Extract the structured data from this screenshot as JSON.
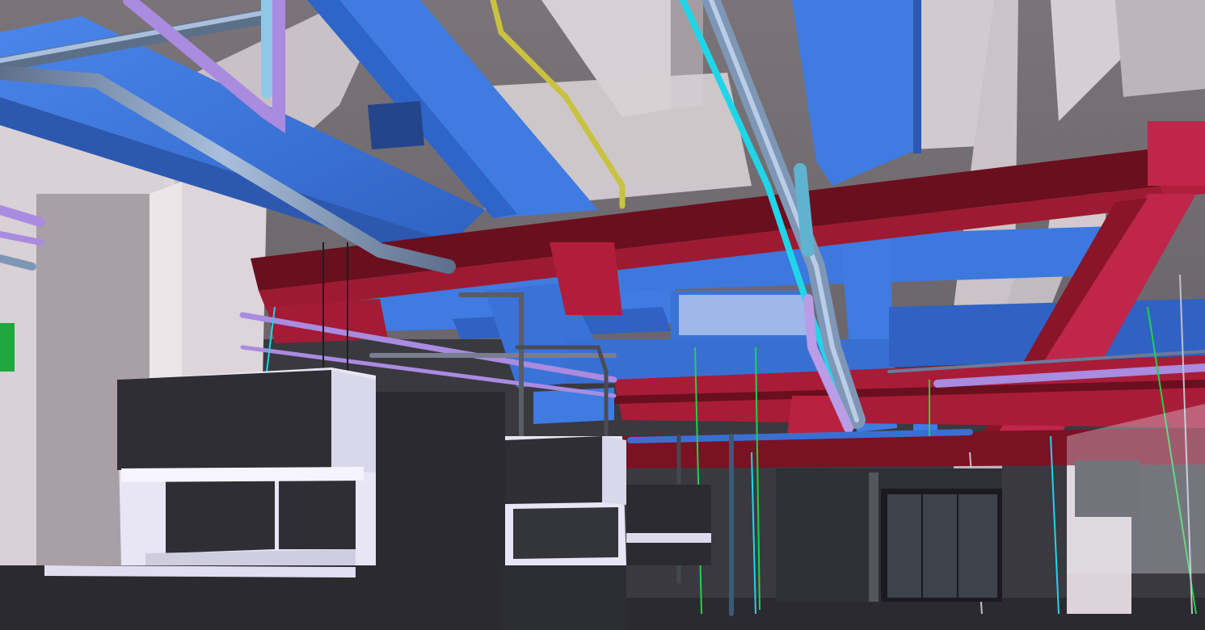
{
  "scene": {
    "kind": "3d-bim-mep-coordination-view",
    "palette": {
      "supply_duct": "#3f7be0",
      "supply_duct_shadow": "#2c58b0",
      "return_duct": "#b01e3c",
      "return_duct_shadow": "#6a0f1e",
      "beam": "#d7cfd3",
      "beam_shadow": "#8f878b",
      "slab": "#6e6a70",
      "purple_pipe": "#a98be0",
      "steel_pipe": "#7f97b6",
      "cyan_pipe": "#1fd6e8",
      "yellow_pipe": "#c9c240",
      "green_pipe": "#20d24a",
      "cabinet": "#2e2e34",
      "cabinet_frame": "#e8e6f4",
      "floor": "#2b2a30"
    }
  }
}
